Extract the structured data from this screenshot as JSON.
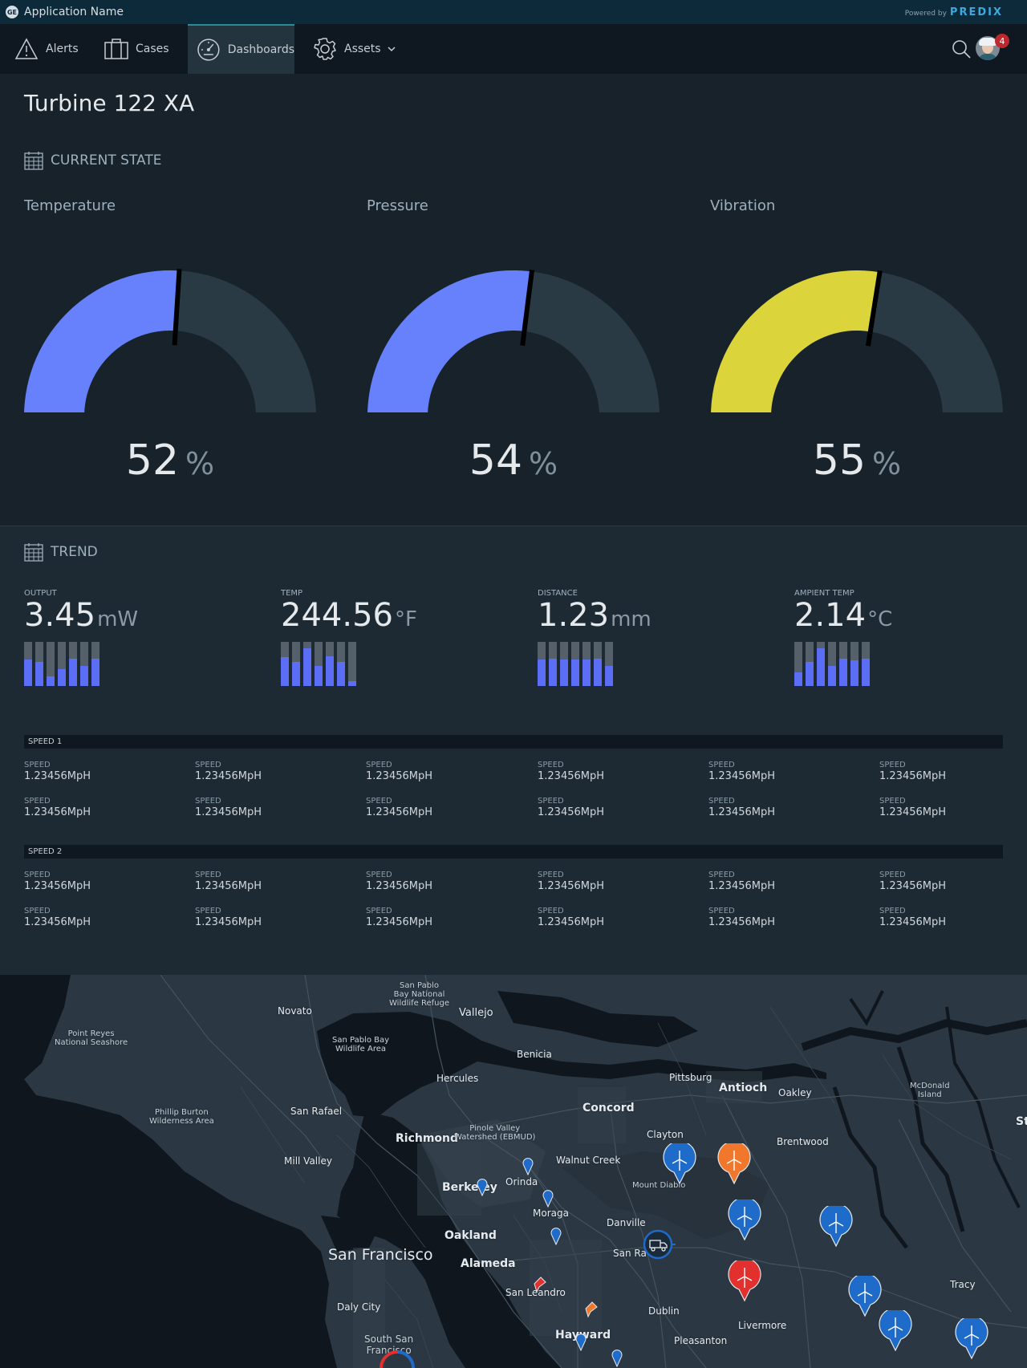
{
  "app": {
    "name": "Application Name",
    "logo": "GE",
    "powered_by": "Powered by",
    "brand": "PREDIX"
  },
  "nav": {
    "items": [
      {
        "label": "Alerts",
        "icon": "warning-triangle-icon",
        "active": false
      },
      {
        "label": "Cases",
        "icon": "briefcase-icon",
        "active": false
      },
      {
        "label": "Dashboards",
        "icon": "dashboard-gauge-icon",
        "active": true
      },
      {
        "label": "Assets",
        "icon": "gear-icon",
        "active": false
      }
    ],
    "notification_count": "4"
  },
  "page": {
    "title": "Turbine 122 XA"
  },
  "current_state": {
    "heading": "CURRENT STATE",
    "gauges": [
      {
        "label": "Temperature",
        "value": "52",
        "unit": "%",
        "level": 52,
        "color": "#6681fb"
      },
      {
        "label": "Pressure",
        "value": "54",
        "unit": "%",
        "level": 54,
        "color": "#6681fb"
      },
      {
        "label": "Vibration",
        "value": "55",
        "unit": "%",
        "level": 55,
        "color": "#dbd43a"
      }
    ]
  },
  "trend": {
    "heading": "TREND",
    "kpis": [
      {
        "label": "OUTPUT",
        "value": "3.45",
        "unit": "mW",
        "bars": [
          0.6,
          0.55,
          0.22,
          0.38,
          0.62,
          0.45,
          0.62
        ]
      },
      {
        "label": "TEMP",
        "value": "244.56",
        "unit": "°F",
        "bars": [
          0.65,
          0.55,
          0.85,
          0.45,
          0.68,
          0.55,
          0.1
        ]
      },
      {
        "label": "DISTANCE",
        "value": "1.23",
        "unit": "mm",
        "bars": [
          0.6,
          0.62,
          0.6,
          0.6,
          0.6,
          0.62,
          0.45
        ]
      },
      {
        "label": "AMPIENT TEMP",
        "value": "2.14",
        "unit": "°C",
        "bars": [
          0.3,
          0.55,
          0.85,
          0.45,
          0.62,
          0.58,
          0.62
        ]
      }
    ],
    "speed_groups": [
      {
        "title": "SPEED 1",
        "cells": [
          {
            "label": "SPEED",
            "value": "1.23456MpH"
          },
          {
            "label": "SPEED",
            "value": "1.23456MpH"
          },
          {
            "label": "SPEED",
            "value": "1.23456MpH"
          },
          {
            "label": "SPEED",
            "value": "1.23456MpH"
          },
          {
            "label": "SPEED",
            "value": "1.23456MpH"
          },
          {
            "label": "SPEED",
            "value": "1.23456MpH"
          },
          {
            "label": "SPEED",
            "value": "1.23456MpH"
          },
          {
            "label": "SPEED",
            "value": "1.23456MpH"
          },
          {
            "label": "SPEED",
            "value": "1.23456MpH"
          },
          {
            "label": "SPEED",
            "value": "1.23456MpH"
          },
          {
            "label": "SPEED",
            "value": "1.23456MpH"
          },
          {
            "label": "SPEED",
            "value": "1.23456MpH"
          }
        ]
      },
      {
        "title": "SPEED 2",
        "cells": [
          {
            "label": "SPEED",
            "value": "1.23456MpH"
          },
          {
            "label": "SPEED",
            "value": "1.23456MpH"
          },
          {
            "label": "SPEED",
            "value": "1.23456MpH"
          },
          {
            "label": "SPEED",
            "value": "1.23456MpH"
          },
          {
            "label": "SPEED",
            "value": "1.23456MpH"
          },
          {
            "label": "SPEED",
            "value": "1.23456MpH"
          },
          {
            "label": "SPEED",
            "value": "1.23456MpH"
          },
          {
            "label": "SPEED",
            "value": "1.23456MpH"
          },
          {
            "label": "SPEED",
            "value": "1.23456MpH"
          },
          {
            "label": "SPEED",
            "value": "1.23456MpH"
          },
          {
            "label": "SPEED",
            "value": "1.23456MpH"
          },
          {
            "label": "SPEED",
            "value": "1.23456MpH"
          }
        ]
      }
    ]
  },
  "map": {
    "places": {
      "san_pablo_refuge": "San Pablo\nBay National\nWildlife Refuge",
      "vallejo": "Vallejo",
      "novato": "Novato",
      "point_reyes": "Point Reyes\nNational Seashore",
      "san_pablo_bay": "San Pablo Bay\nWildlife Area",
      "benicia": "Benicia",
      "hercules": "Hercules",
      "pittsburg": "Pittsburg",
      "antioch": "Antioch",
      "oakley": "Oakley",
      "mcdonald_island": "McDonald\nIsland",
      "phillip_burton": "Phillip Burton\nWilderness Area",
      "san_rafael": "San Rafael",
      "concord": "Concord",
      "richmond": "Richmond",
      "pinole_valley": "Pinole Valley\nWatershed (EBMUD)",
      "clayton": "Clayton",
      "brentwood": "Brentwood",
      "mill_valley": "Mill Valley",
      "walnut_creek": "Walnut Creek",
      "berkeley": "Berkeley",
      "orinda": "Orinda",
      "mount_diablo": "Mount Diablo",
      "moraga": "Moraga",
      "danville": "Danville",
      "oakland": "Oakland",
      "san_francisco": "San Francisco",
      "san_ramon": "San Ra",
      "alameda": "Alameda",
      "tracy": "Tracy",
      "san_leandro": "San Leandro",
      "daly_city": "Daly City",
      "dublin": "Dublin",
      "livermore": "Livermore",
      "south_sf": "South San\nFrancisco",
      "hayward": "Hayward",
      "pleasanton": "Pleasanton",
      "stockton": "St"
    },
    "colors": {
      "water": "#0f161d",
      "land": "#2b3742",
      "pin_blue": "#1f6bc9",
      "pin_orange": "#f0772b",
      "pin_red": "#e2302e"
    }
  }
}
